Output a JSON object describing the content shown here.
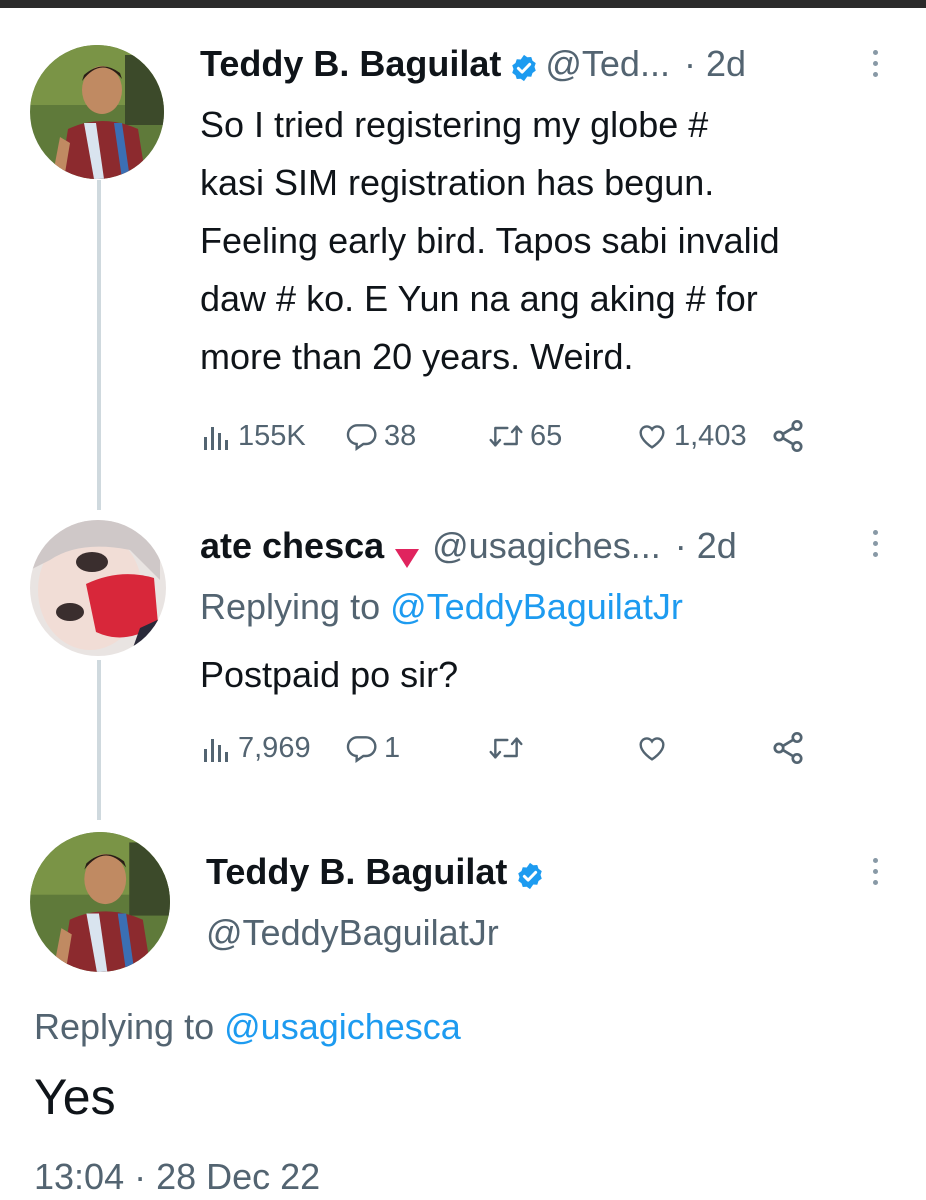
{
  "tweets": [
    {
      "name": "Teddy B. Baguilat",
      "handle": "@Ted...",
      "time": "· 2d",
      "text_lines": [
        "So I tried registering my globe #",
        "kasi SIM registration has begun.",
        "Feeling early bird. Tapos sabi invalid",
        "daw # ko. E Yun na ang aking # for",
        "more than 20 years. Weird."
      ],
      "stats": {
        "views": "155K",
        "replies": "38",
        "retweets": "65",
        "likes": "1,403"
      }
    },
    {
      "name": "ate chesca",
      "handle": "@usagiches...",
      "time": "· 2d",
      "replying_label": "Replying to",
      "replying_to": "@TeddyBaguilatJr",
      "text": "Postpaid po sir?",
      "stats": {
        "views": "7,969",
        "replies": "1"
      }
    }
  ],
  "main_tweet": {
    "name": "Teddy B. Baguilat",
    "handle": "@TeddyBaguilatJr",
    "replying_label": "Replying to",
    "replying_to": "@usagichesca",
    "text": "Yes",
    "timestamp": "13:04 · 28 Dec 22"
  },
  "colors": {
    "accent": "#1d9bf0",
    "muted": "#536471",
    "thread_line": "#cfd9de",
    "verified": "#1d9bf0",
    "red_badge": "#e0245e"
  },
  "icons": [
    "views-icon",
    "reply-icon",
    "retweet-icon",
    "like-icon",
    "share-icon",
    "verified-icon",
    "more-icon"
  ]
}
